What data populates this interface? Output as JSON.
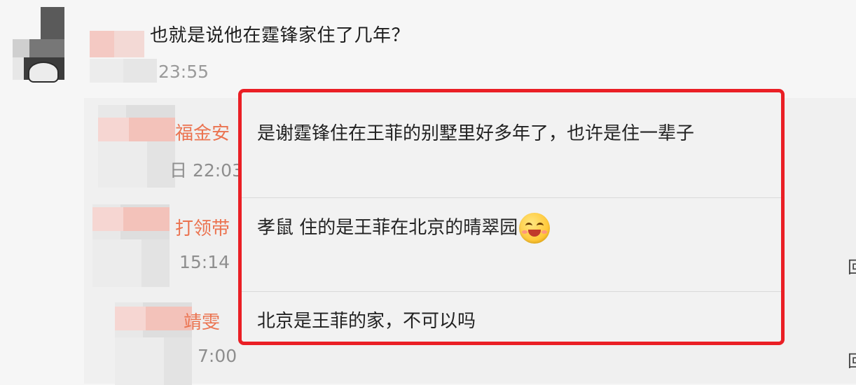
{
  "top_comment": {
    "text": "也就是说他在霆锋家住了几年？",
    "time": "23:55"
  },
  "replies": [
    {
      "name_partial": "福金安",
      "time_partial": "日 22:03"
    },
    {
      "name_partial": "打领带",
      "time_partial": "15:14"
    },
    {
      "name_partial": "靖雯",
      "time_partial": "7:00"
    }
  ],
  "highlighted_comments": [
    {
      "text": "是谢霆锋住在王菲的别墅里好多年了，也许是住一辈子"
    },
    {
      "text": "孝鼠 住的是王菲在北京的晴翠园",
      "emoji": "smile-blush-emoji"
    },
    {
      "text": "北京是王菲的家，不可以吗"
    }
  ],
  "colors": {
    "highlight_border": "#ea1f25",
    "username": "#eb7350",
    "timestamp": "#8e8e8e"
  }
}
